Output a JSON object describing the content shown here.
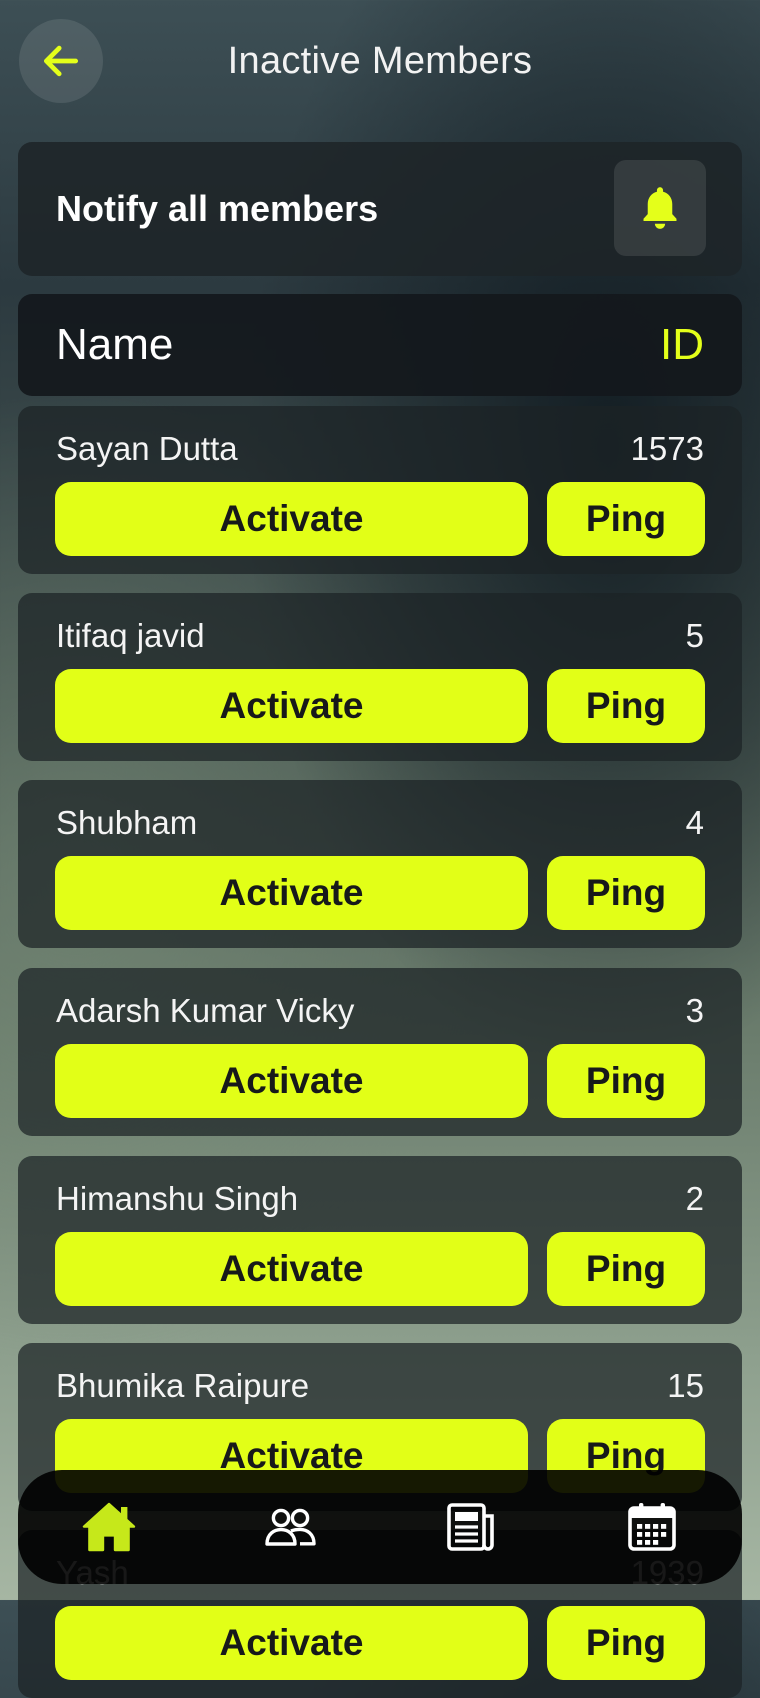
{
  "header": {
    "title": "Inactive Members"
  },
  "notify": {
    "label": "Notify all members"
  },
  "table": {
    "name_header": "Name",
    "id_header": "ID"
  },
  "actions": {
    "activate_label": "Activate",
    "ping_label": "Ping"
  },
  "members": [
    {
      "name": "Sayan Dutta",
      "id": "1573"
    },
    {
      "name": "Itifaq javid",
      "id": "5"
    },
    {
      "name": "Shubham",
      "id": "4"
    },
    {
      "name": "Adarsh Kumar Vicky",
      "id": "3"
    },
    {
      "name": "Himanshu Singh",
      "id": "2"
    },
    {
      "name": "Bhumika Raipure",
      "id": "15"
    },
    {
      "name": "Yash",
      "id": "1939"
    }
  ],
  "bottom_nav": {
    "items": [
      {
        "icon": "home-icon",
        "active": true
      },
      {
        "icon": "members-icon",
        "active": false
      },
      {
        "icon": "news-icon",
        "active": false
      },
      {
        "icon": "calendar-icon",
        "active": false
      }
    ]
  },
  "colors": {
    "accent": "#e2ff17",
    "card_bg": "#1c2226",
    "nav_bg": "#000000",
    "text": "#ffffff"
  }
}
